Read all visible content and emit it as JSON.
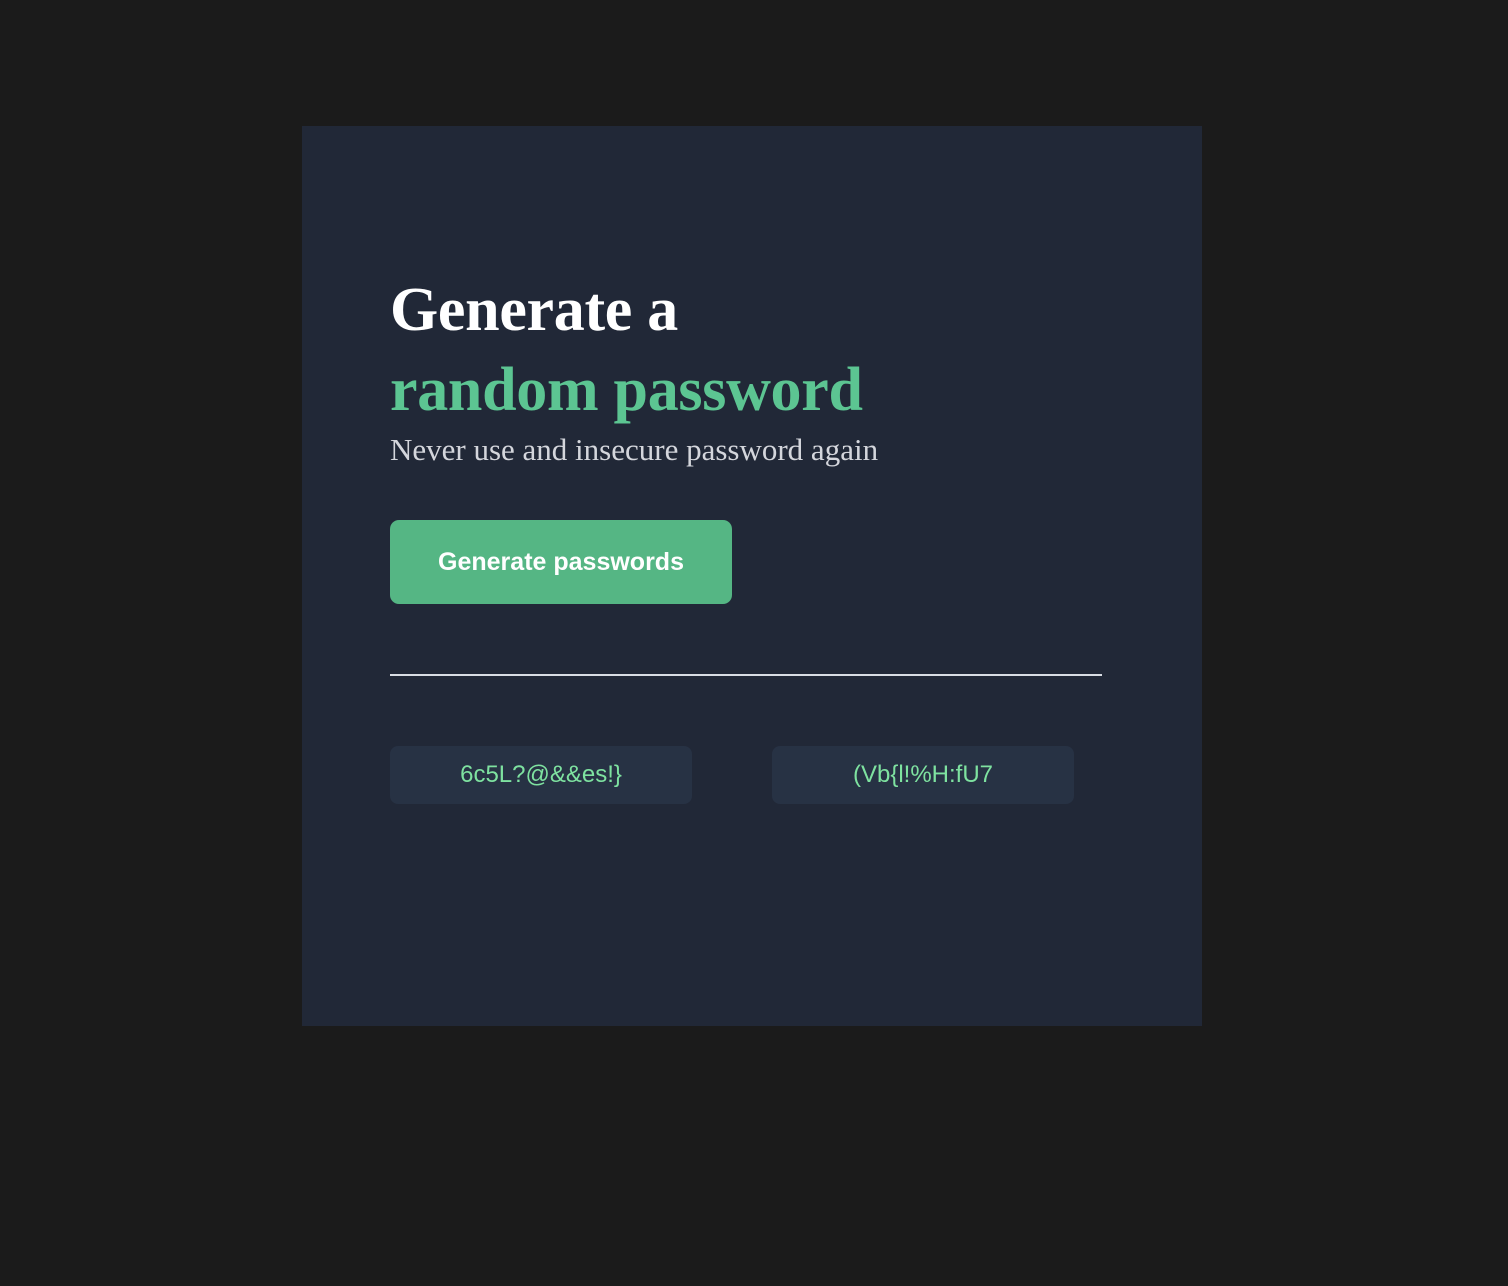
{
  "header": {
    "title_line1": "Generate a",
    "title_line2": "random password",
    "subtitle": "Never use and insecure password again"
  },
  "actions": {
    "generate_label": "Generate passwords"
  },
  "results": {
    "passwords": [
      "6c5L?@&&es!}",
      "(Vb{l!%H:fU7"
    ]
  },
  "colors": {
    "page_background": "#1b1b1b",
    "card_background": "#212837",
    "accent": "#55b684",
    "title_accent": "#5cc592",
    "password_text": "#7ee2a0",
    "password_background": "#273244"
  }
}
